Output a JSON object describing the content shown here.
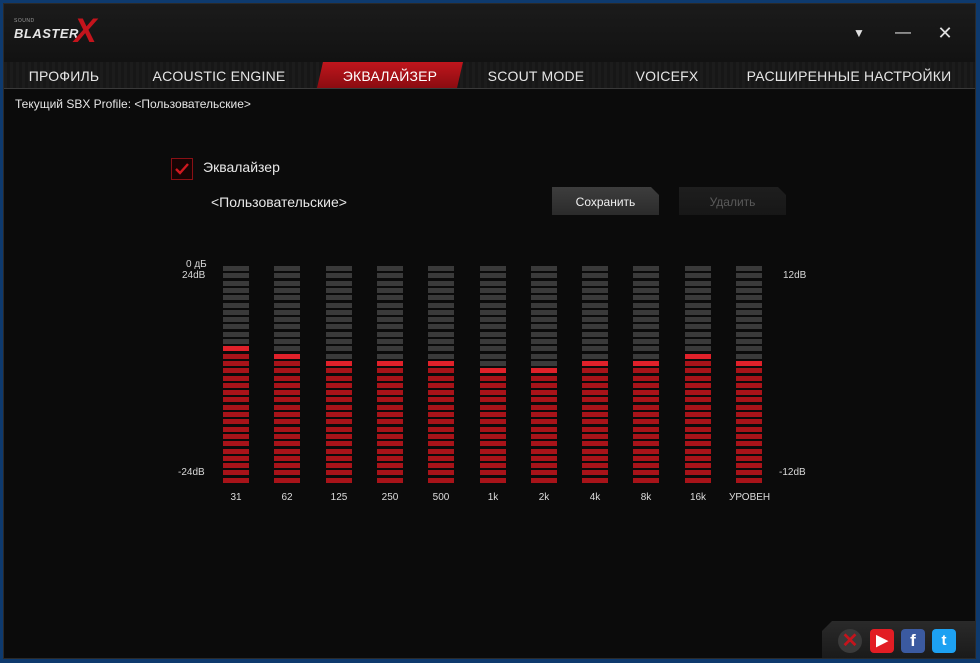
{
  "app": {
    "logo_small": "SOUND",
    "logo_main": "BLASTER",
    "logo_x": "X",
    "menu_icon": "▼",
    "minimize_icon": "—",
    "close_icon": "✕"
  },
  "tabs": [
    {
      "label": "ПРОФИЛЬ",
      "active": false
    },
    {
      "label": "ACOUSTIC ENGINE",
      "active": false
    },
    {
      "label": "ЭКВАЛАЙЗЕР",
      "active": true
    },
    {
      "label": "SCOUT MODE",
      "active": false
    },
    {
      "label": "VOICEFX",
      "active": false
    },
    {
      "label": "РАСШИРЕННЫЕ НАСТРОЙКИ",
      "active": false
    }
  ],
  "profile": {
    "text": "Текущий SBX Profile: <Пользовательские>"
  },
  "equalizer": {
    "enabled": true,
    "label": "Эквалайзер",
    "preset": "<Пользовательские>",
    "save_label": "Сохранить",
    "delete_label": "Удалить",
    "axis_left_top_1": "0 дБ",
    "axis_left_top_2": "24dB",
    "axis_left_bottom": "-24dB",
    "axis_right_top": "12dB",
    "axis_right_bottom": "-12dB",
    "segments_per_band": 30,
    "colors": {
      "active": "#a81319",
      "knob": "#e0212a",
      "inactive": "#3a3a3a"
    },
    "bands": [
      {
        "label": "31",
        "level": 19
      },
      {
        "label": "62",
        "level": 18
      },
      {
        "label": "125",
        "level": 17
      },
      {
        "label": "250",
        "level": 17
      },
      {
        "label": "500",
        "level": 17
      },
      {
        "label": "1k",
        "level": 16
      },
      {
        "label": "2k",
        "level": 16
      },
      {
        "label": "4k",
        "level": 17
      },
      {
        "label": "8k",
        "level": 17
      },
      {
        "label": "16k",
        "level": 18
      },
      {
        "label": "УРОВЕН",
        "level": 17
      }
    ]
  },
  "social": {
    "icons": [
      "close-circle-icon",
      "youtube-icon",
      "facebook-icon",
      "twitter-icon"
    ],
    "fb_glyph": "f",
    "yt_glyph": "▶",
    "tw_glyph": "t",
    "x_glyph": "✕"
  }
}
